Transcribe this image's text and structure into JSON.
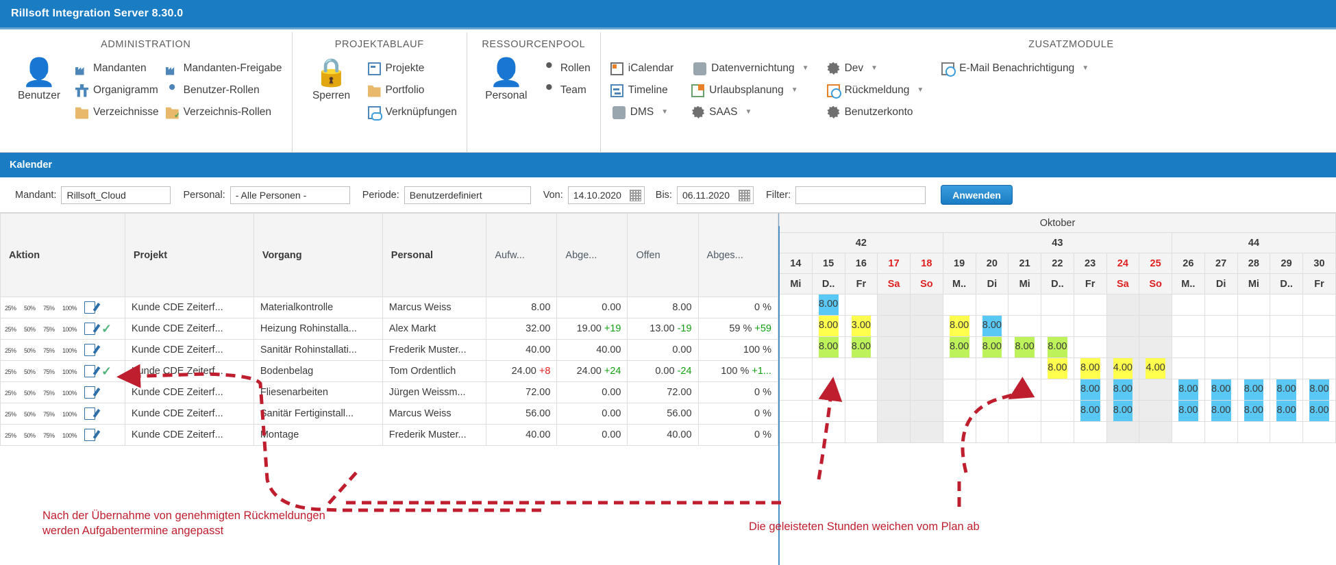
{
  "window": {
    "title": "Rillsoft Integration Server 8.30.0"
  },
  "ribbon": {
    "groups": [
      {
        "title": "ADMINISTRATION",
        "big": {
          "label": "Benutzer",
          "icon": "user-icon"
        },
        "columns": [
          [
            {
              "label": "Mandanten",
              "icon": "factory-icon"
            },
            {
              "label": "Organigramm",
              "icon": "org-chart-icon"
            },
            {
              "label": "Verzeichnisse",
              "icon": "folder-icon"
            }
          ],
          [
            {
              "label": "Mandanten-Freigabe",
              "icon": "factory-check-icon"
            },
            {
              "label": "Benutzer-Rollen",
              "icon": "user-check-icon"
            },
            {
              "label": "Verzeichnis-Rollen",
              "icon": "folder-check-icon"
            }
          ]
        ]
      },
      {
        "title": "PROJEKTABLAUF",
        "big": {
          "label": "Sperren",
          "icon": "lock-icon"
        },
        "columns": [
          [
            {
              "label": "Projekte",
              "icon": "window-icon"
            },
            {
              "label": "Portfolio",
              "icon": "folder-window-icon"
            },
            {
              "label": "Verknüpfungen",
              "icon": "link-icon"
            }
          ]
        ]
      },
      {
        "title": "RESSOURCENPOOL",
        "big": {
          "label": "Personal",
          "icon": "person-green-icon"
        },
        "columns": [
          [
            {
              "label": "Rollen",
              "icon": "person-icon"
            },
            {
              "label": "Team",
              "icon": "team-icon"
            }
          ]
        ]
      },
      {
        "title": "ZUSATZMODULE",
        "big": null,
        "columns": [
          [
            {
              "label": "iCalendar",
              "icon": "calendar-grid-icon"
            },
            {
              "label": "Timeline",
              "icon": "timeline-icon"
            },
            {
              "label": "DMS",
              "icon": "clip-icon",
              "caret": true
            }
          ],
          [
            {
              "label": "Datenvernichtung",
              "icon": "trash-icon",
              "caret": true
            },
            {
              "label": "Urlaubsplanung",
              "icon": "holiday-icon",
              "caret": true
            },
            {
              "label": "SAAS",
              "icon": "gears-icon",
              "caret": true
            }
          ],
          [
            {
              "label": "Dev",
              "icon": "gears-icon",
              "caret": true
            },
            {
              "label": "Rückmeldung",
              "icon": "calendar-clock-icon",
              "caret": true
            },
            {
              "label": "Benutzerkonto",
              "icon": "gears-icon"
            }
          ],
          [
            {
              "label": "E-Mail Benachrichtigung",
              "icon": "mail-clock-icon",
              "caret": true
            }
          ]
        ]
      }
    ]
  },
  "section": {
    "title": "Kalender"
  },
  "filterbar": {
    "mandant_label": "Mandant:",
    "mandant_value": "Rillsoft_Cloud",
    "personal_label": "Personal:",
    "personal_value": "- Alle Personen -",
    "periode_label": "Periode:",
    "periode_value": "Benutzerdefiniert",
    "von_label": "Von:",
    "von_value": "14.10.2020",
    "bis_label": "Bis:",
    "bis_value": "06.11.2020",
    "filter_label": "Filter:",
    "filter_value": "",
    "filter_placeholder": "",
    "apply_label": "Anwenden"
  },
  "grid": {
    "columns": [
      "Aktion",
      "Projekt",
      "Vorgang",
      "Personal",
      "Aufw...",
      "Abge...",
      "Offen",
      "Abges..."
    ],
    "rows": [
      {
        "pct": [
          100,
          100,
          100,
          100
        ],
        "check": false,
        "projekt": "Kunde CDE Zeiterf...",
        "vorgang": "Materialkontrolle",
        "personal": "Marcus Weiss",
        "aufwand": "8.00",
        "aufwand_delta": "",
        "abgel": "0.00",
        "abgel_delta": "",
        "offen": "8.00",
        "offen_delta": "",
        "abgeschl": "0 %",
        "abgeschl_delta": ""
      },
      {
        "pct": [
          0,
          0,
          100,
          100
        ],
        "check": true,
        "projekt": "Kunde CDE Zeiterf...",
        "vorgang": "Heizung Rohinstalla...",
        "personal": "Alex Markt",
        "aufwand": "32.00",
        "aufwand_delta": "",
        "abgel": "19.00",
        "abgel_delta": "+19",
        "offen": "13.00",
        "offen_delta": "-19",
        "abgeschl": "59 %",
        "abgeschl_delta": "+59"
      },
      {
        "pct": [
          0,
          0,
          0,
          0
        ],
        "check": false,
        "projekt": "Kunde CDE Zeiterf...",
        "vorgang": "Sanitär Rohinstallati...",
        "personal": "Frederik Muster...",
        "aufwand": "40.00",
        "aufwand_delta": "",
        "abgel": "40.00",
        "abgel_delta": "",
        "offen": "0.00",
        "offen_delta": "",
        "abgeschl": "100 %",
        "abgeschl_delta": ""
      },
      {
        "pct": [
          0,
          0,
          0,
          0
        ],
        "check": true,
        "projekt": "Kunde CDE Zeiterf...",
        "vorgang": "Bodenbelag",
        "personal": "Tom Ordentlich",
        "aufwand": "24.00",
        "aufwand_delta": "+8",
        "aufwand_delta_color": "neg",
        "abgel": "24.00",
        "abgel_delta": "+24",
        "offen": "0.00",
        "offen_delta": "-24",
        "abgeschl": "100 %",
        "abgeschl_delta": "+1..."
      },
      {
        "pct": [
          100,
          100,
          100,
          100
        ],
        "check": false,
        "projekt": "Kunde CDE Zeiterf...",
        "vorgang": "Fliesenarbeiten",
        "personal": "Jürgen Weissm...",
        "aufwand": "72.00",
        "aufwand_delta": "",
        "abgel": "0.00",
        "abgel_delta": "",
        "offen": "72.00",
        "offen_delta": "",
        "abgeschl": "0 %",
        "abgeschl_delta": ""
      },
      {
        "pct": [
          100,
          100,
          100,
          100
        ],
        "check": false,
        "projekt": "Kunde CDE Zeiterf...",
        "vorgang": "Sanitär Fertiginstall...",
        "personal": "Marcus Weiss",
        "aufwand": "56.00",
        "aufwand_delta": "",
        "abgel": "0.00",
        "abgel_delta": "",
        "offen": "56.00",
        "offen_delta": "",
        "abgeschl": "0 %",
        "abgeschl_delta": ""
      },
      {
        "pct": [
          100,
          100,
          100,
          100
        ],
        "check": false,
        "projekt": "Kunde CDE Zeiterf...",
        "vorgang": "Montage",
        "personal": "Frederik Muster...",
        "aufwand": "40.00",
        "aufwand_delta": "",
        "abgel": "0.00",
        "abgel_delta": "",
        "offen": "40.00",
        "offen_delta": "",
        "abgeschl": "0 %",
        "abgeschl_delta": ""
      }
    ],
    "pct_labels": [
      "25%",
      "50%",
      "75%",
      "100%"
    ]
  },
  "calendar": {
    "month": "Oktober",
    "weeks": [
      {
        "label": "42",
        "span": 5
      },
      {
        "label": "43",
        "span": 7
      },
      {
        "label": "44",
        "span": 5
      }
    ],
    "days": [
      {
        "num": "14",
        "name": "Mi",
        "weekend": false
      },
      {
        "num": "15",
        "name": "D..",
        "weekend": false
      },
      {
        "num": "16",
        "name": "Fr",
        "weekend": false
      },
      {
        "num": "17",
        "name": "Sa",
        "weekend": true
      },
      {
        "num": "18",
        "name": "So",
        "weekend": true
      },
      {
        "num": "19",
        "name": "M..",
        "weekend": false
      },
      {
        "num": "20",
        "name": "Di",
        "weekend": false
      },
      {
        "num": "21",
        "name": "Mi",
        "weekend": false
      },
      {
        "num": "22",
        "name": "D..",
        "weekend": false
      },
      {
        "num": "23",
        "name": "Fr",
        "weekend": false
      },
      {
        "num": "24",
        "name": "Sa",
        "weekend": true
      },
      {
        "num": "25",
        "name": "So",
        "weekend": true
      },
      {
        "num": "26",
        "name": "M..",
        "weekend": false
      },
      {
        "num": "27",
        "name": "Di",
        "weekend": false
      },
      {
        "num": "28",
        "name": "Mi",
        "weekend": false
      },
      {
        "num": "29",
        "name": "D..",
        "weekend": false
      },
      {
        "num": "30",
        "name": "Fr",
        "weekend": false
      }
    ],
    "cells": [
      [
        null,
        {
          "v": "8.00",
          "c": "blue"
        },
        null,
        null,
        null,
        null,
        null,
        null,
        null,
        null,
        null,
        null,
        null,
        null,
        null,
        null,
        null
      ],
      [
        null,
        {
          "v": "8.00",
          "c": "yellow"
        },
        {
          "v": "3.00",
          "c": "yellow"
        },
        null,
        null,
        {
          "v": "8.00",
          "c": "yellow"
        },
        {
          "v": "8.00",
          "c": "blue"
        },
        null,
        null,
        null,
        null,
        null,
        null,
        null,
        null,
        null,
        null
      ],
      [
        null,
        {
          "v": "8.00",
          "c": "green"
        },
        {
          "v": "8.00",
          "c": "green"
        },
        null,
        null,
        {
          "v": "8.00",
          "c": "green"
        },
        {
          "v": "8.00",
          "c": "green"
        },
        {
          "v": "8.00",
          "c": "green"
        },
        {
          "v": "8.00",
          "c": "green"
        },
        null,
        null,
        null,
        null,
        null,
        null,
        null,
        null
      ],
      [
        null,
        null,
        null,
        null,
        null,
        null,
        null,
        null,
        {
          "v": "8.00",
          "c": "yellow"
        },
        {
          "v": "8.00",
          "c": "yellow"
        },
        {
          "v": "4.00",
          "c": "yellow"
        },
        {
          "v": "4.00",
          "c": "yellow"
        },
        null,
        null,
        null,
        null,
        null
      ],
      [
        null,
        null,
        null,
        null,
        null,
        null,
        null,
        null,
        null,
        {
          "v": "8.00",
          "c": "blue"
        },
        {
          "v": "8.00",
          "c": "blue"
        },
        null,
        {
          "v": "8.00",
          "c": "blue"
        },
        {
          "v": "8.00",
          "c": "blue"
        },
        {
          "v": "8.00",
          "c": "blue"
        },
        {
          "v": "8.00",
          "c": "blue"
        },
        {
          "v": "8.00",
          "c": "blue"
        }
      ],
      [
        null,
        null,
        null,
        null,
        null,
        null,
        null,
        null,
        null,
        {
          "v": "8.00",
          "c": "blue"
        },
        {
          "v": "8.00",
          "c": "blue"
        },
        null,
        {
          "v": "8.00",
          "c": "blue"
        },
        {
          "v": "8.00",
          "c": "blue"
        },
        {
          "v": "8.00",
          "c": "blue"
        },
        {
          "v": "8.00",
          "c": "blue"
        },
        {
          "v": "8.00",
          "c": "blue"
        }
      ],
      [
        null,
        null,
        null,
        null,
        null,
        null,
        null,
        null,
        null,
        null,
        null,
        null,
        null,
        null,
        null,
        null,
        null
      ]
    ]
  },
  "annotations": {
    "left_line1": "Nach der Übernahme von genehmigten Rückmeldungen",
    "left_line2": "werden Aufgabentermine angepasst",
    "right_line1": "Die geleisteten Stunden weichen vom Plan ab",
    "color": "#bf1e2e"
  }
}
